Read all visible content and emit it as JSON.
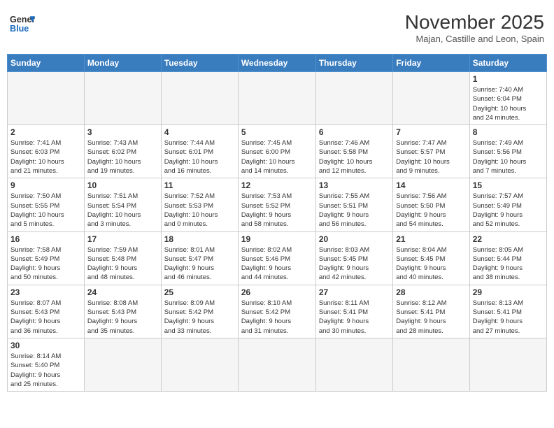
{
  "header": {
    "logo_general": "General",
    "logo_blue": "Blue",
    "month_title": "November 2025",
    "subtitle": "Majan, Castille and Leon, Spain"
  },
  "weekdays": [
    "Sunday",
    "Monday",
    "Tuesday",
    "Wednesday",
    "Thursday",
    "Friday",
    "Saturday"
  ],
  "weeks": [
    [
      {
        "day": "",
        "info": ""
      },
      {
        "day": "",
        "info": ""
      },
      {
        "day": "",
        "info": ""
      },
      {
        "day": "",
        "info": ""
      },
      {
        "day": "",
        "info": ""
      },
      {
        "day": "",
        "info": ""
      },
      {
        "day": "1",
        "info": "Sunrise: 7:40 AM\nSunset: 6:04 PM\nDaylight: 10 hours\nand 24 minutes."
      }
    ],
    [
      {
        "day": "2",
        "info": "Sunrise: 7:41 AM\nSunset: 6:03 PM\nDaylight: 10 hours\nand 21 minutes."
      },
      {
        "day": "3",
        "info": "Sunrise: 7:43 AM\nSunset: 6:02 PM\nDaylight: 10 hours\nand 19 minutes."
      },
      {
        "day": "4",
        "info": "Sunrise: 7:44 AM\nSunset: 6:01 PM\nDaylight: 10 hours\nand 16 minutes."
      },
      {
        "day": "5",
        "info": "Sunrise: 7:45 AM\nSunset: 6:00 PM\nDaylight: 10 hours\nand 14 minutes."
      },
      {
        "day": "6",
        "info": "Sunrise: 7:46 AM\nSunset: 5:58 PM\nDaylight: 10 hours\nand 12 minutes."
      },
      {
        "day": "7",
        "info": "Sunrise: 7:47 AM\nSunset: 5:57 PM\nDaylight: 10 hours\nand 9 minutes."
      },
      {
        "day": "8",
        "info": "Sunrise: 7:49 AM\nSunset: 5:56 PM\nDaylight: 10 hours\nand 7 minutes."
      }
    ],
    [
      {
        "day": "9",
        "info": "Sunrise: 7:50 AM\nSunset: 5:55 PM\nDaylight: 10 hours\nand 5 minutes."
      },
      {
        "day": "10",
        "info": "Sunrise: 7:51 AM\nSunset: 5:54 PM\nDaylight: 10 hours\nand 3 minutes."
      },
      {
        "day": "11",
        "info": "Sunrise: 7:52 AM\nSunset: 5:53 PM\nDaylight: 10 hours\nand 0 minutes."
      },
      {
        "day": "12",
        "info": "Sunrise: 7:53 AM\nSunset: 5:52 PM\nDaylight: 9 hours\nand 58 minutes."
      },
      {
        "day": "13",
        "info": "Sunrise: 7:55 AM\nSunset: 5:51 PM\nDaylight: 9 hours\nand 56 minutes."
      },
      {
        "day": "14",
        "info": "Sunrise: 7:56 AM\nSunset: 5:50 PM\nDaylight: 9 hours\nand 54 minutes."
      },
      {
        "day": "15",
        "info": "Sunrise: 7:57 AM\nSunset: 5:49 PM\nDaylight: 9 hours\nand 52 minutes."
      }
    ],
    [
      {
        "day": "16",
        "info": "Sunrise: 7:58 AM\nSunset: 5:49 PM\nDaylight: 9 hours\nand 50 minutes."
      },
      {
        "day": "17",
        "info": "Sunrise: 7:59 AM\nSunset: 5:48 PM\nDaylight: 9 hours\nand 48 minutes."
      },
      {
        "day": "18",
        "info": "Sunrise: 8:01 AM\nSunset: 5:47 PM\nDaylight: 9 hours\nand 46 minutes."
      },
      {
        "day": "19",
        "info": "Sunrise: 8:02 AM\nSunset: 5:46 PM\nDaylight: 9 hours\nand 44 minutes."
      },
      {
        "day": "20",
        "info": "Sunrise: 8:03 AM\nSunset: 5:45 PM\nDaylight: 9 hours\nand 42 minutes."
      },
      {
        "day": "21",
        "info": "Sunrise: 8:04 AM\nSunset: 5:45 PM\nDaylight: 9 hours\nand 40 minutes."
      },
      {
        "day": "22",
        "info": "Sunrise: 8:05 AM\nSunset: 5:44 PM\nDaylight: 9 hours\nand 38 minutes."
      }
    ],
    [
      {
        "day": "23",
        "info": "Sunrise: 8:07 AM\nSunset: 5:43 PM\nDaylight: 9 hours\nand 36 minutes."
      },
      {
        "day": "24",
        "info": "Sunrise: 8:08 AM\nSunset: 5:43 PM\nDaylight: 9 hours\nand 35 minutes."
      },
      {
        "day": "25",
        "info": "Sunrise: 8:09 AM\nSunset: 5:42 PM\nDaylight: 9 hours\nand 33 minutes."
      },
      {
        "day": "26",
        "info": "Sunrise: 8:10 AM\nSunset: 5:42 PM\nDaylight: 9 hours\nand 31 minutes."
      },
      {
        "day": "27",
        "info": "Sunrise: 8:11 AM\nSunset: 5:41 PM\nDaylight: 9 hours\nand 30 minutes."
      },
      {
        "day": "28",
        "info": "Sunrise: 8:12 AM\nSunset: 5:41 PM\nDaylight: 9 hours\nand 28 minutes."
      },
      {
        "day": "29",
        "info": "Sunrise: 8:13 AM\nSunset: 5:41 PM\nDaylight: 9 hours\nand 27 minutes."
      }
    ],
    [
      {
        "day": "30",
        "info": "Sunrise: 8:14 AM\nSunset: 5:40 PM\nDaylight: 9 hours\nand 25 minutes."
      },
      {
        "day": "",
        "info": ""
      },
      {
        "day": "",
        "info": ""
      },
      {
        "day": "",
        "info": ""
      },
      {
        "day": "",
        "info": ""
      },
      {
        "day": "",
        "info": ""
      },
      {
        "day": "",
        "info": ""
      }
    ]
  ]
}
